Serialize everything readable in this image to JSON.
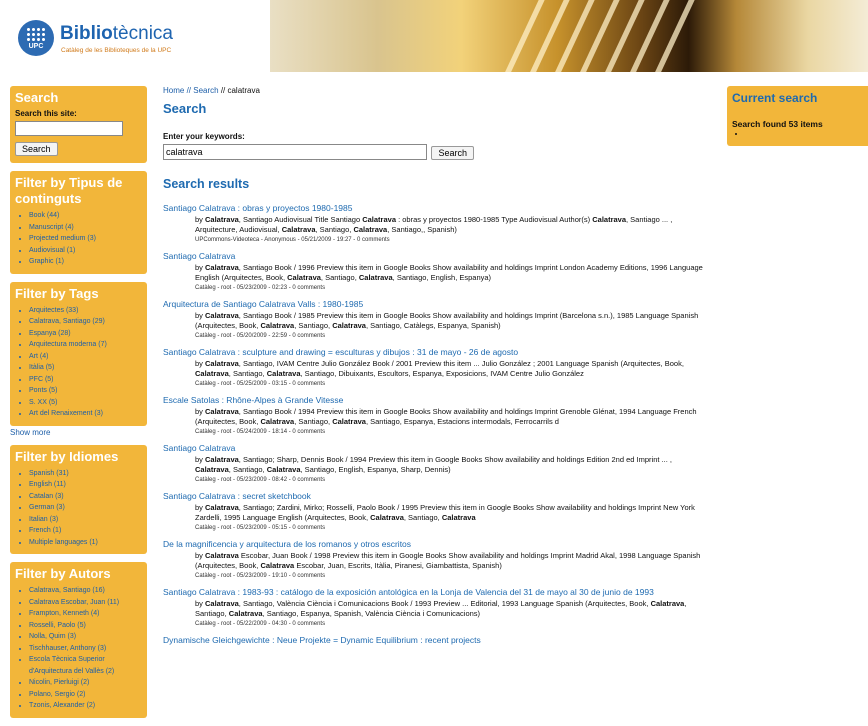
{
  "header": {
    "logo_text": "UPC",
    "brand_bold": "Biblio",
    "brand_rest": "tècnica",
    "brand_sub": "Catàleg de les Biblioteques de la UPC"
  },
  "sidebar": {
    "search": {
      "title": "Search",
      "label": "Search this site:",
      "value": "",
      "button": "Search"
    },
    "filters": [
      {
        "title": "Filter by Tipus de continguts",
        "items": [
          "Book (44)",
          "Manuscript (4)",
          "Projected medium (3)",
          "Audiovisual (1)",
          "Graphic (1)"
        ]
      },
      {
        "title": "Filter by Tags",
        "items": [
          "Arquitectes (33)",
          "Calatrava, Santiago (29)",
          "Espanya (28)",
          "Arquitectura moderna (7)",
          "Art (4)",
          "Itàlia (5)",
          "PFC (5)",
          "Ponts (5)",
          "S. XX (5)",
          "Art del Renaixement (3)"
        ]
      },
      {
        "title": "Filter by Idiomes",
        "items": [
          "Spanish (31)",
          "English (11)",
          "Catalan (3)",
          "German (3)",
          "Italian (3)",
          "French (1)",
          "Multiple languages (1)"
        ]
      },
      {
        "title": "Filter by Autors",
        "items": [
          "Calatrava, Santiago (16)",
          "Calatrava Escobar, Juan (11)",
          "Frampton, Kenneth (4)",
          "Rosselli, Paolo (5)",
          "Nolla, Quim (3)",
          "Tischhauser, Anthony (3)",
          "Escola Tècnica Superior d'Arquitectura del Vallès (2)",
          "Nicolin, Pierluigi (2)",
          "Polano, Sergio (2)",
          "Tzonis, Alexander (2)"
        ]
      }
    ],
    "show_more": "Show more"
  },
  "main": {
    "breadcrumb": {
      "home": "Home",
      "sep1": " // ",
      "search": "Search",
      "sep2": " // ",
      "current": "calatrava"
    },
    "title": "Search",
    "keywords_label": "Enter your keywords:",
    "keywords_value": "calatrava",
    "search_button": "Search",
    "results_title": "Search results",
    "results": [
      {
        "title": "Santiago Calatrava : obras y proyectos 1980-1985",
        "snippet": [
          [
            "by "
          ],
          [
            "Calatrava",
            1
          ],
          [
            ", Santiago Audiovisual Title Santiago "
          ],
          [
            "Calatrava",
            1
          ],
          [
            " : obras y proyectos 1980-1985 Type Audiovisual Author(s) "
          ],
          [
            "Calatrava",
            1
          ],
          [
            ", Santiago ... , Arquitecture, Audiovisual, "
          ],
          [
            "Calatrava",
            1
          ],
          [
            ", Santiago, "
          ],
          [
            "Calatrava",
            1
          ],
          [
            ", Santiago,, Spanish)"
          ]
        ],
        "meta": "UPCommons-Videoteca - Anonymous - 05/21/2009 - 19:27 - 0 comments"
      },
      {
        "title": "Santiago Calatrava",
        "snippet": [
          [
            "by "
          ],
          [
            "Calatrava",
            1
          ],
          [
            ", Santiago Book / 1996 Preview this item in Google Books Show availability and holdings Imprint London Academy Editions, 1996 Language English (Arquitectes, Book, "
          ],
          [
            "Calatrava",
            1
          ],
          [
            ", Santiago, "
          ],
          [
            "Calatrava",
            1
          ],
          [
            ", Santiago, English, Espanya)"
          ]
        ],
        "meta": "Catàleg - root - 05/23/2009 - 02:23 - 0 comments"
      },
      {
        "title": "Arquitectura de Santiago Calatrava Valls : 1980-1985",
        "snippet": [
          [
            "by "
          ],
          [
            "Calatrava",
            1
          ],
          [
            ", Santiago Book / 1985 Preview this item in Google Books Show availability and holdings Imprint (Barcelona s.n.), 1985 Language Spanish (Arquitectes, Book, "
          ],
          [
            "Calatrava",
            1
          ],
          [
            ", Santiago, "
          ],
          [
            "Calatrava",
            1
          ],
          [
            ", Santiago, Catàlegs, Espanya, Spanish)"
          ]
        ],
        "meta": "Catàleg - root - 05/20/2009 - 22:59 - 0 comments"
      },
      {
        "title": "Santiago Calatrava : sculpture and drawing = esculturas y dibujos : 31 de mayo - 26 de agosto",
        "snippet": [
          [
            "by "
          ],
          [
            "Calatrava",
            1
          ],
          [
            ", Santiago, IVAM Centre Julio González Book / 2001 Preview this item ... Julio González ; 2001 Language Spanish (Arquitectes, Book, "
          ],
          [
            "Calatrava",
            1
          ],
          [
            ", Santiago, "
          ],
          [
            "Calatrava",
            1
          ],
          [
            ", Santiago, Dibuixants, Escultors, Espanya, Exposicions, IVAM Centre Julio González"
          ]
        ],
        "meta": "Catàleg - root - 05/25/2009 - 03:15 - 0 comments"
      },
      {
        "title": "Escale Satolas : Rhône-Alpes à Grande Vitesse",
        "snippet": [
          [
            "by "
          ],
          [
            "Calatrava",
            1
          ],
          [
            ", Santiago Book / 1994 Preview this item in Google Books Show availability and holdings Imprint Grenoble Glénat, 1994 Language French (Arquitectes, Book, "
          ],
          [
            "Calatrava",
            1
          ],
          [
            ", Santiago, "
          ],
          [
            "Calatrava",
            1
          ],
          [
            ", Santiago, Espanya, Estacions intermodals, Ferrocarrils d"
          ]
        ],
        "meta": "Catàleg - root - 05/24/2009 - 18:14 - 0 comments"
      },
      {
        "title": "Santiago Calatrava",
        "snippet": [
          [
            "by "
          ],
          [
            "Calatrava",
            1
          ],
          [
            ", Santiago; Sharp, Dennis Book / 1994 Preview this item in Google Books Show availability and holdings Edition 2nd ed Imprint ... , "
          ],
          [
            "Calatrava",
            1
          ],
          [
            ", Santiago, "
          ],
          [
            "Calatrava",
            1
          ],
          [
            ", Santiago, English, Espanya, Sharp, Dennis)"
          ]
        ],
        "meta": "Catàleg - root - 05/23/2009 - 08:42 - 0 comments"
      },
      {
        "title": "Santiago Calatrava : secret sketchbook",
        "snippet": [
          [
            "by "
          ],
          [
            "Calatrava",
            1
          ],
          [
            ", Santiago; Zardini, Mirko; Rosselli, Paolo Book / 1995 Preview this item in Google Books Show availability and holdings Imprint New York Zardelli, 1995 Language English (Arquitectes, Book, "
          ],
          [
            "Calatrava",
            1
          ],
          [
            ", Santiago, "
          ],
          [
            "Calatrava",
            1
          ]
        ],
        "meta": "Catàleg - root - 05/23/2009 - 05:15 - 0 comments"
      },
      {
        "title": "De la magnificencia y arquitectura de los romanos y otros escritos",
        "snippet": [
          [
            "by "
          ],
          [
            "Calatrava",
            1
          ],
          [
            " Escobar, Juan Book / 1998 Preview this item in Google Books Show availability and holdings Imprint Madrid Akal, 1998 Language Spanish (Arquitectes, Book, "
          ],
          [
            "Calatrava",
            1
          ],
          [
            " Escobar, Juan, Escrits, Itàlia, Piranesi, Giambattista, Spanish)"
          ]
        ],
        "meta": "Catàleg - root - 05/23/2009 - 19:10 - 0 comments"
      },
      {
        "title": "Santiago Calatrava : 1983-93 : catálogo de la exposición antológica en la Lonja de Valencia del 31 de mayo al 30 de junio de 1993",
        "snippet": [
          [
            "by "
          ],
          [
            "Calatrava",
            1
          ],
          [
            ", Santiago, València Ciència i Comunicacions Book / 1993 Preview ... Editorial, 1993 Language Spanish (Arquitectes, Book, "
          ],
          [
            "Calatrava",
            1
          ],
          [
            ", Santiago, "
          ],
          [
            "Calatrava",
            1
          ],
          [
            ", Santiago, Espanya, Spanish, València Ciència i Comunicacions)"
          ]
        ],
        "meta": "Catàleg - root - 05/22/2009 - 04:30 - 0 comments"
      },
      {
        "title": "Dynamische Gleichgewichte : Neue Projekte = Dynamic Equilibrium : recent projects",
        "snippet": [],
        "meta": ""
      }
    ]
  },
  "right": {
    "title": "Current search",
    "found": "Search found 53 items",
    "item": ""
  }
}
